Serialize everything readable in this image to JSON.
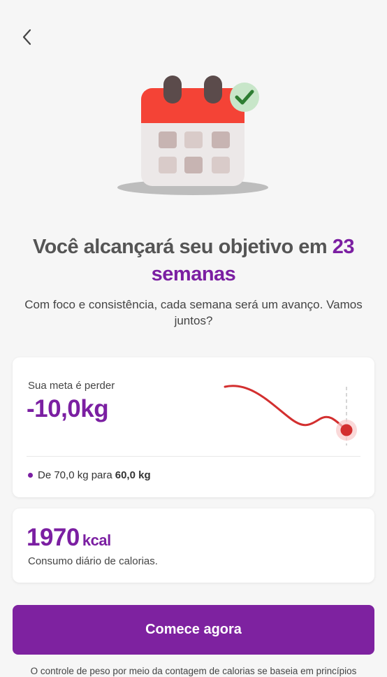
{
  "header": {
    "back_icon": "chevron-left-icon"
  },
  "hero": {
    "icon": "calendar-check-icon"
  },
  "headline": {
    "prefix": "Você alcançará seu objetivo em ",
    "highlight_number": "23",
    "highlight_unit": "semanas"
  },
  "subtitle": "Com foco e consistência, cada semana será um avanço. Vamos juntos?",
  "goal": {
    "label": "Sua meta é perder",
    "value": "-10,0kg",
    "range_prefix": "De 70,0 kg para",
    "range_target": "60,0 kg"
  },
  "calories": {
    "value": "1970",
    "unit": "kcal",
    "label": "Consumo diário de calorias."
  },
  "cta": {
    "label": "Comece agora"
  },
  "footer": {
    "disclaimer": "O controle de peso por meio da contagem de calorias se baseia em princípios"
  },
  "colors": {
    "accent": "#7b1fa2",
    "button": "#7e22a0",
    "trend_line": "#d32f2f",
    "calendar_header": "#f44336",
    "check": "#2e7d32"
  }
}
